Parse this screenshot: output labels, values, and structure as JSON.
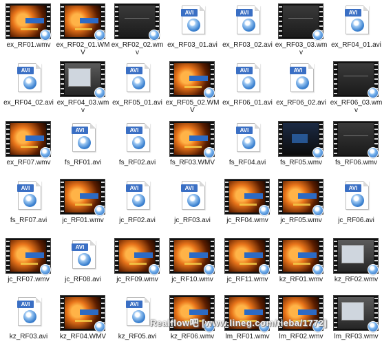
{
  "files": [
    {
      "name": "ex_RF01.wmv",
      "icon": "video-thumb-orange"
    },
    {
      "name": "ex_RF02_01.WMV",
      "icon": "video-thumb-orange"
    },
    {
      "name": "ex_RF02_02.wmv",
      "icon": "video-thumb-dark"
    },
    {
      "name": "ex_RF03_01.avi",
      "icon": "avi-file-icon"
    },
    {
      "name": "ex_RF03_02.avi",
      "icon": "avi-file-icon"
    },
    {
      "name": "ex_RF03_03.wmv",
      "icon": "video-thumb-dark"
    },
    {
      "name": "ex_RF04_01.avi",
      "icon": "avi-file-icon"
    },
    {
      "name": "ex_RF04_02.avi",
      "icon": "avi-file-icon"
    },
    {
      "name": "ex_RF04_03.wmv",
      "icon": "video-thumb-gray"
    },
    {
      "name": "ex_RF05_01.avi",
      "icon": "avi-file-icon"
    },
    {
      "name": "ex_RF05_02.WMV",
      "icon": "video-thumb-orange"
    },
    {
      "name": "ex_RF06_01.avi",
      "icon": "avi-file-icon"
    },
    {
      "name": "ex_RF06_02.avi",
      "icon": "avi-file-icon"
    },
    {
      "name": "ex_RF06_03.wmv",
      "icon": "video-thumb-dark"
    },
    {
      "name": "ex_RF07.wmv",
      "icon": "video-thumb-orange"
    },
    {
      "name": "fs_RF01.avi",
      "icon": "avi-file-icon"
    },
    {
      "name": "fs_RF02.avi",
      "icon": "avi-file-icon"
    },
    {
      "name": "fs_RF03.WMV",
      "icon": "video-thumb-orange"
    },
    {
      "name": "fs_RF04.avi",
      "icon": "avi-file-icon"
    },
    {
      "name": "fs_RF05.wmv",
      "icon": "video-thumb-dark2"
    },
    {
      "name": "fs_RF06.wmv",
      "icon": "video-thumb-dark"
    },
    {
      "name": "fs_RF07.avi",
      "icon": "avi-file-icon"
    },
    {
      "name": "jc_RF01.wmv",
      "icon": "video-thumb-orange"
    },
    {
      "name": "jc_RF02.avi",
      "icon": "avi-file-icon"
    },
    {
      "name": "jc_RF03.avi",
      "icon": "avi-file-icon"
    },
    {
      "name": "jc_RF04.wmv",
      "icon": "video-thumb-orange"
    },
    {
      "name": "jc_RF05.wmv",
      "icon": "video-thumb-orange"
    },
    {
      "name": "jc_RF06.avi",
      "icon": "avi-file-icon"
    },
    {
      "name": "jc_RF07.wmv",
      "icon": "video-thumb-orange"
    },
    {
      "name": "jc_RF08.avi",
      "icon": "avi-file-icon"
    },
    {
      "name": "jc_RF09.wmv",
      "icon": "video-thumb-orange"
    },
    {
      "name": "jc_RF10.wmv",
      "icon": "video-thumb-orange"
    },
    {
      "name": "jc_RF11.wmv",
      "icon": "video-thumb-orange"
    },
    {
      "name": "kz_RF01.wmv",
      "icon": "video-thumb-orange"
    },
    {
      "name": "kz_RF02.wmv",
      "icon": "video-thumb-gray"
    },
    {
      "name": "kz_RF03.avi",
      "icon": "avi-file-icon"
    },
    {
      "name": "kz_RF04.WMV",
      "icon": "video-thumb-orange"
    },
    {
      "name": "kz_RF05.avi",
      "icon": "avi-file-icon"
    },
    {
      "name": "kz_RF06.wmv",
      "icon": "video-thumb-orange"
    },
    {
      "name": "lm_RF01.wmv",
      "icon": "video-thumb-orange"
    },
    {
      "name": "lm_RF02.wmv",
      "icon": "video-thumb-orange"
    },
    {
      "name": "lm_RF03.wmv",
      "icon": "video-thumb-gray"
    }
  ],
  "avi_label": "AVI",
  "watermark": "Realflow吧 [www.lineg.com/tieba/1772]"
}
